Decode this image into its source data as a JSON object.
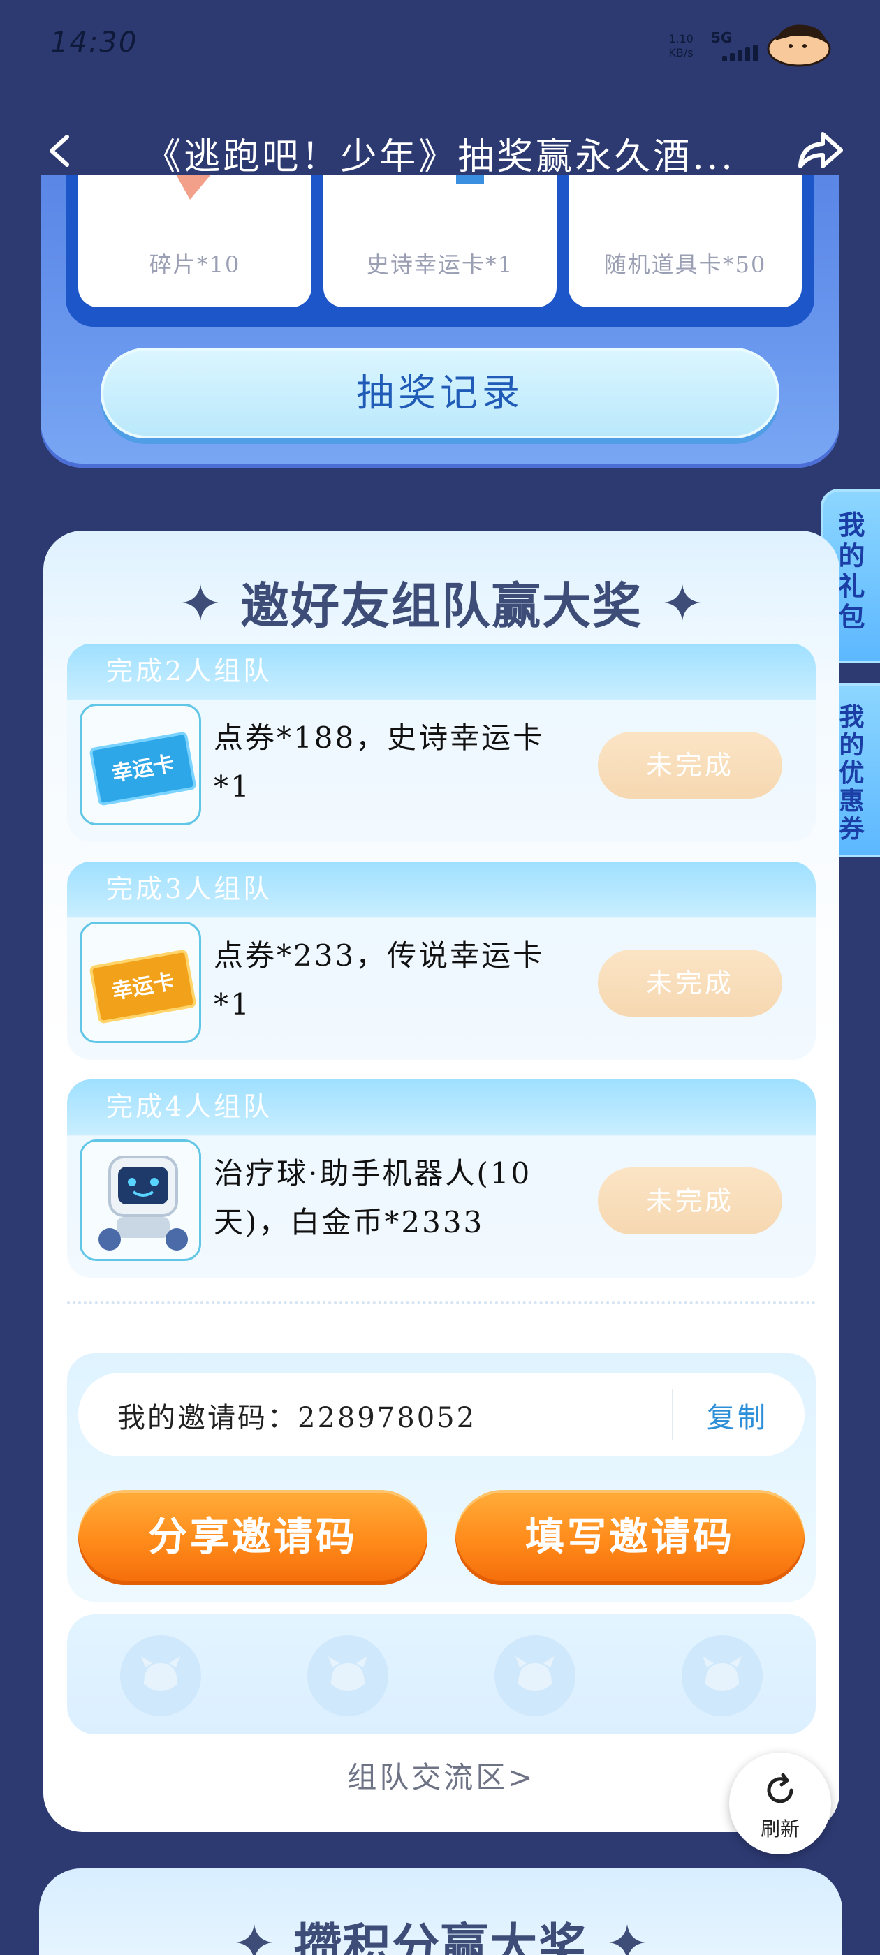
{
  "status_bar": {
    "time": "14:30",
    "net_speed_value": "1.10",
    "net_speed_unit": "KB/s",
    "network": "5G"
  },
  "header": {
    "title": "《逃跑吧！少年》抽奖赢永久酒...",
    "back_icon": "chevron-left-icon",
    "share_icon": "share-arrow-icon"
  },
  "prizes": {
    "items": [
      {
        "label": "碎片*10"
      },
      {
        "label": "史诗幸运卡*1"
      },
      {
        "label": "随机道具卡*50"
      }
    ],
    "draw_record_label": "抽奖记录"
  },
  "side_tabs": {
    "my_gift": "我的礼包",
    "my_coupon": "我的优惠券"
  },
  "team": {
    "title": "邀好友组队赢大奖",
    "tasks": [
      {
        "head": "完成2人组队",
        "desc": "点券*188，史诗幸运卡*1",
        "status": "未完成",
        "icon": "lucky-card-blue-icon"
      },
      {
        "head": "完成3人组队",
        "desc": "点券*233，传说幸运卡*1",
        "status": "未完成",
        "icon": "lucky-card-gold-icon"
      },
      {
        "head": "完成4人组队",
        "desc": "治疗球·助手机器人(10天)，白金币*2333",
        "status": "未完成",
        "icon": "robot-icon"
      }
    ],
    "invite_code_label": "我的邀请码：",
    "invite_code": "228978052",
    "copy_label": "复制",
    "share_code_label": "分享邀请码",
    "fill_code_label": "填写邀请码",
    "team_link_label": "组队交流区>"
  },
  "refresh_label": "刷新",
  "points_section": {
    "title": "攒积分赢大奖"
  },
  "colors": {
    "background": "#2d3a72",
    "accent_orange": "#ff8a1a",
    "accent_blue": "#1f5bb7",
    "status_pending": "#f6d8b1"
  }
}
